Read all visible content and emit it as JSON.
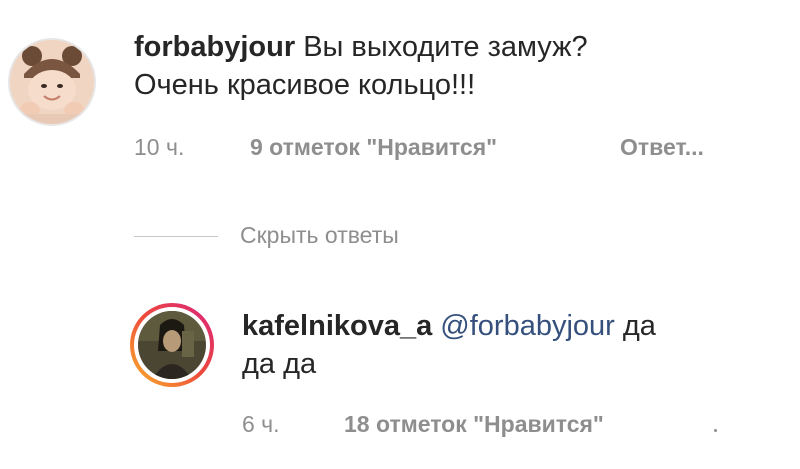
{
  "comments": [
    {
      "username": "forbabyjour",
      "text_line1": "Вы выходите замуж?",
      "text_line2": "Очень красивое кольцо!!!",
      "time": "10 ч.",
      "likes": "9 отметок \"Нравится\"",
      "reply_label": "Ответ..."
    }
  ],
  "hide_replies_label": "Скрыть ответы",
  "replies": [
    {
      "username": "kafelnikova_a",
      "mention": "@forbabyjour",
      "text_line1_rest": "да",
      "text_line2": "да да",
      "time": "6 ч.",
      "likes": "18 отметок \"Нравится\""
    }
  ],
  "colors": {
    "text": "#262626",
    "secondary": "#8e8e8e",
    "mention": "#36507d",
    "story_ring_start": "#f9b52b",
    "story_ring_end": "#d8237e"
  }
}
